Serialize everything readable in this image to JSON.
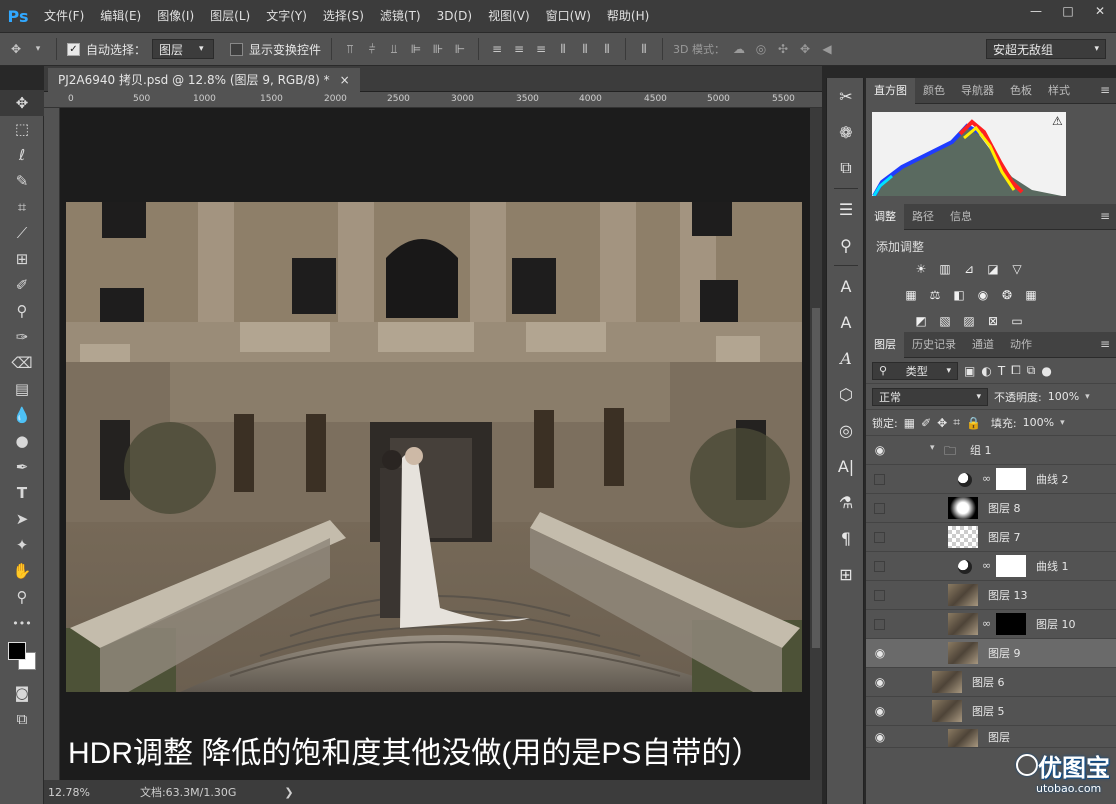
{
  "app": {
    "logo": "Ps",
    "menu": [
      "文件(F)",
      "编辑(E)",
      "图像(I)",
      "图层(L)",
      "文字(Y)",
      "选择(S)",
      "滤镜(T)",
      "3D(D)",
      "视图(V)",
      "窗口(W)",
      "帮助(H)"
    ],
    "window_controls": [
      "—",
      "□",
      "✕"
    ]
  },
  "options_bar": {
    "auto_select_label": "自动选择：",
    "auto_select_value": "图层",
    "auto_select_checked": true,
    "show_transform_label": "显示变换控件",
    "show_transform_checked": false,
    "mode_3d_label": "3D 模式：",
    "workspace": "安超无敌组"
  },
  "document": {
    "tab_title": "PJ2A6940 拷贝.psd @ 12.8% (图层 9, RGB/8) *",
    "tab_close": "×",
    "ruler_ticks": [
      "0",
      "500",
      "1000",
      "1500",
      "2000",
      "2500",
      "3000",
      "3500",
      "4000",
      "4500",
      "5000",
      "5500"
    ],
    "caption": "HDR调整 降低的饱和度其他没做(用的是PS自带的）"
  },
  "status": {
    "zoom": "12.78%",
    "doc_size": "文档:63.3M/1.30G"
  },
  "panels": {
    "top_tabs": [
      "直方图",
      "颜色",
      "导航器",
      "色板",
      "样式"
    ],
    "mid_tabs": [
      "调整",
      "路径",
      "信息"
    ],
    "adjust_title": "添加调整",
    "layer_tabs": [
      "图层",
      "历史记录",
      "通道",
      "动作"
    ],
    "filter_type": "类型",
    "blend_mode": "正常",
    "opacity_label": "不透明度:",
    "opacity_value": "100%",
    "lock_label": "锁定:",
    "fill_label": "填充:",
    "fill_value": "100%",
    "layers": [
      {
        "name": "组 1",
        "visible": true,
        "kind": "group"
      },
      {
        "name": "曲线 2",
        "visible": false,
        "kind": "curve"
      },
      {
        "name": "图层 8",
        "visible": false,
        "kind": "glow"
      },
      {
        "name": "图层 7",
        "visible": false,
        "kind": "empty"
      },
      {
        "name": "曲线 1",
        "visible": false,
        "kind": "curve-mask"
      },
      {
        "name": "图层 13",
        "visible": false,
        "kind": "photo"
      },
      {
        "name": "图层 10",
        "visible": false,
        "kind": "photo-mask"
      },
      {
        "name": "图层 9",
        "visible": true,
        "kind": "photo",
        "selected": true
      },
      {
        "name": "图层 6",
        "visible": true,
        "kind": "photo"
      },
      {
        "name": "图层 5",
        "visible": true,
        "kind": "photo"
      },
      {
        "name": "图层",
        "visible": true,
        "kind": "photo"
      }
    ]
  },
  "watermark": {
    "main": "优图宝",
    "sub": "utobao.com"
  },
  "colors": {
    "accent": "#31a8ff",
    "panel": "#535353",
    "dark": "#3c3c3c"
  }
}
